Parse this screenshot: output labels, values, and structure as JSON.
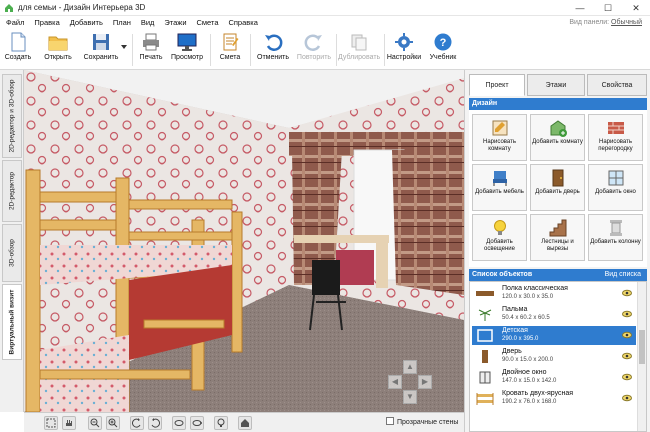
{
  "window": {
    "title": "для семьи - Дизайн Интерьера 3D",
    "controls": [
      "minimize-icon",
      "maximize-icon",
      "close-icon"
    ]
  },
  "menu": {
    "items": [
      "Файл",
      "Правка",
      "Добавить",
      "План",
      "Вид",
      "Этажи",
      "Смета",
      "Справка"
    ],
    "view_panel_label": "Вид панели:",
    "view_panel_value": "Обычный"
  },
  "toolbar": {
    "buttons": [
      {
        "label": "Создать",
        "icon": "new-file-icon"
      },
      {
        "label": "Открыть",
        "icon": "open-folder-icon"
      },
      {
        "label": "Сохранить",
        "icon": "save-icon"
      },
      {
        "label": "Печать",
        "icon": "printer-icon"
      },
      {
        "label": "Просмотр",
        "icon": "monitor-icon"
      },
      {
        "label": "Смета",
        "icon": "estimate-icon"
      },
      {
        "label": "Отменить",
        "icon": "undo-icon"
      },
      {
        "label": "Повторить",
        "icon": "redo-icon",
        "disabled": true
      },
      {
        "label": "Дублировать",
        "icon": "duplicate-icon",
        "disabled": true
      },
      {
        "label": "Настройки",
        "icon": "gear-icon"
      },
      {
        "label": "Учебник",
        "icon": "help-icon"
      }
    ]
  },
  "view_tabs": [
    {
      "label": "2D-редактор и 3D-обзор"
    },
    {
      "label": "2D-редактор"
    },
    {
      "label": "3D-обзор"
    },
    {
      "label": "Виртуальный визит",
      "active": true
    }
  ],
  "bottom": {
    "transparent_walls": "Прозрачные стены",
    "tools": [
      "select-icon",
      "hand-icon",
      "zoom-out-icon",
      "zoom-in-icon",
      "rotate-left-icon",
      "rotate-right-icon",
      "orbit-left-icon",
      "orbit-right-icon",
      "light-icon",
      "home-icon"
    ]
  },
  "right_panel": {
    "tabs": [
      "Проект",
      "Этажи",
      "Свойства"
    ],
    "design_header": "Дизайн",
    "design_buttons": [
      {
        "label": "Нарисовать комнату",
        "icon": "draw-room-icon"
      },
      {
        "label": "Добавить комнату",
        "icon": "add-room-icon"
      },
      {
        "label": "Нарисовать перегородку",
        "icon": "wall-icon"
      },
      {
        "label": "Добавить мебель",
        "icon": "chair-icon"
      },
      {
        "label": "Добавить дверь",
        "icon": "door-icon"
      },
      {
        "label": "Добавить окно",
        "icon": "window-icon"
      },
      {
        "label": "Добавить освещение",
        "icon": "bulb-icon"
      },
      {
        "label": "Лестницы и вырезы",
        "icon": "stairs-icon"
      },
      {
        "label": "Добавить колонну",
        "icon": "column-icon"
      }
    ],
    "objects_header": "Список объектов",
    "objects_view": "Вид списка",
    "objects": [
      {
        "name": "Полка классическая",
        "size": "120.0 x 30.0 x 35.0"
      },
      {
        "name": "Пальма",
        "size": "50.4 x 60.2 x 60.5"
      },
      {
        "name": "Детская",
        "size": "290.0 x 395.0",
        "selected": true
      },
      {
        "name": "Дверь",
        "size": "90.0 x 15.0 x 200.0"
      },
      {
        "name": "Двойное окно",
        "size": "147.0 x 15.0 x 142.0"
      },
      {
        "name": "Кровать двух-ярусная",
        "size": "190.2 x 76.0 x 168.0"
      }
    ]
  },
  "colors": {
    "accent": "#2f7ccf",
    "wallpaper": "#e9e3df",
    "floor": "#8c7d78",
    "bed_wood": "#e0b15a",
    "bed_mattress": "#b83a32"
  }
}
